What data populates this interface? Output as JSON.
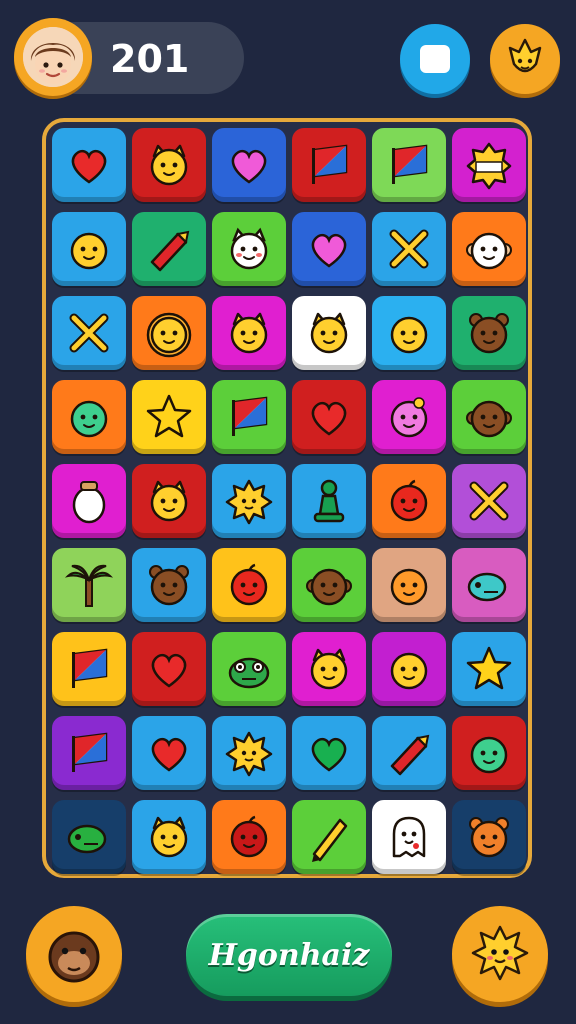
{
  "hud": {
    "score": "201",
    "avatar_icon": "player-avatar-icon",
    "stop_icon": "stop-icon",
    "character_icon": "character-icon"
  },
  "board": {
    "rows": 9,
    "cols": 6,
    "tiles": [
      [
        {
          "color": "#2ba4e8",
          "icon": "heart"
        },
        {
          "color": "#d01f1f",
          "icon": "cat"
        },
        {
          "color": "#2b64d8",
          "icon": "heart-pink"
        },
        {
          "color": "#d01f1f",
          "icon": "flag"
        },
        {
          "color": "#7ed957",
          "icon": "flag"
        },
        {
          "color": "#d321cf",
          "icon": "badge"
        }
      ],
      [
        {
          "color": "#2ba4e8",
          "icon": "blob"
        },
        {
          "color": "#1fb06e",
          "icon": "crayon"
        },
        {
          "color": "#5ccf3a",
          "icon": "ghost-cat"
        },
        {
          "color": "#2b64d8",
          "icon": "heart-pink"
        },
        {
          "color": "#2ba4e8",
          "icon": "cross"
        },
        {
          "color": "#ff7a1a",
          "icon": "monkey"
        }
      ],
      [
        {
          "color": "#2ba4e8",
          "icon": "cross"
        },
        {
          "color": "#ff7a1a",
          "icon": "lion"
        },
        {
          "color": "#e01fd0",
          "icon": "cat"
        },
        {
          "color": "#ffffff",
          "icon": "cat"
        },
        {
          "color": "#2bb0f0",
          "icon": "blob"
        },
        {
          "color": "#1fb06e",
          "icon": "bear"
        }
      ],
      [
        {
          "color": "#ff7a1a",
          "icon": "blob-green"
        },
        {
          "color": "#ffd21a",
          "icon": "star"
        },
        {
          "color": "#5ccf3a",
          "icon": "flag"
        },
        {
          "color": "#d01f1f",
          "icon": "heart"
        },
        {
          "color": "#e01fd0",
          "icon": "blob-pink"
        },
        {
          "color": "#5ccf3a",
          "icon": "monkey-brown"
        }
      ],
      [
        {
          "color": "#e01fd0",
          "icon": "sheep"
        },
        {
          "color": "#d01f1f",
          "icon": "cat"
        },
        {
          "color": "#2ba4e8",
          "icon": "sun"
        },
        {
          "color": "#2ba4e8",
          "icon": "pawn"
        },
        {
          "color": "#ff7a1a",
          "icon": "apple"
        },
        {
          "color": "#b24fd8",
          "icon": "cross"
        }
      ],
      [
        {
          "color": "#8fd35a",
          "icon": "palm"
        },
        {
          "color": "#2ba4e8",
          "icon": "bear"
        },
        {
          "color": "#ffc21a",
          "icon": "apple"
        },
        {
          "color": "#5ccf3a",
          "icon": "monkey-brown"
        },
        {
          "color": "#e0a582",
          "icon": "blob-orange"
        },
        {
          "color": "#d85cc0",
          "icon": "fish"
        }
      ],
      [
        {
          "color": "#ffc21a",
          "icon": "flag"
        },
        {
          "color": "#d01f1f",
          "icon": "heart"
        },
        {
          "color": "#5ccf3a",
          "icon": "frog"
        },
        {
          "color": "#e01fd0",
          "icon": "cat"
        },
        {
          "color": "#c21fd0",
          "icon": "blob"
        },
        {
          "color": "#2ba4e8",
          "icon": "star"
        }
      ],
      [
        {
          "color": "#8a2ad0",
          "icon": "flag"
        },
        {
          "color": "#2ba4e8",
          "icon": "heart"
        },
        {
          "color": "#2ba4e8",
          "icon": "sun"
        },
        {
          "color": "#2ba4e8",
          "icon": "heart-green"
        },
        {
          "color": "#2ba4e8",
          "icon": "crayon"
        },
        {
          "color": "#d01f1f",
          "icon": "blob-green"
        }
      ],
      [
        {
          "color": "#163e6a",
          "icon": "fish-green"
        },
        {
          "color": "#2ba4e8",
          "icon": "cat"
        },
        {
          "color": "#ff7a1a",
          "icon": "apple-red"
        },
        {
          "color": "#5ccf3a",
          "icon": "pencil"
        },
        {
          "color": "#ffffff",
          "icon": "ghost"
        },
        {
          "color": "#163e6a",
          "icon": "bear-orange"
        }
      ]
    ]
  },
  "footer": {
    "main_button_label": "Hgonhaiz",
    "left_icon": "monkey-face-icon",
    "right_icon": "sun-cat-icon"
  }
}
